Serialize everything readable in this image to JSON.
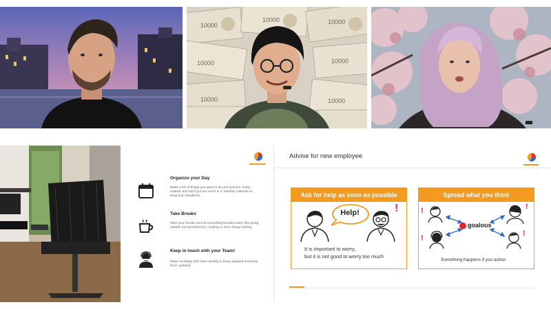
{
  "participants": [
    {
      "name": "",
      "background": "venice-canal"
    },
    {
      "name": "",
      "background": "yen-banknotes"
    },
    {
      "name": "",
      "background": "cherry-blossom"
    },
    {
      "name": "",
      "background": "home-office"
    }
  ],
  "slide1": {
    "tips": [
      {
        "icon": "calendar-icon",
        "title": "Organize your Day",
        "body": "Make a list of things you want to do and achieve. Keep realistic and don't put too much in it. Monthly calendar to keep your deadlines."
      },
      {
        "icon": "coffee-cup-icon",
        "title": "Take Breaks",
        "body": "Take your breaks and do something besides work, like going outside (social distance), cooking or even doing nothing."
      },
      {
        "icon": "headset-person-icon",
        "title": "Keep in touch with your Team!",
        "body": "Make meetings with them weekly to keep updated and keep them updated."
      }
    ]
  },
  "slide2": {
    "title": "Advise for new employee",
    "panel_left": {
      "header": "Ask for help as soon as possible",
      "bubble": "Help!",
      "caption_line1": "It is important to worry,",
      "caption_line2": "but it is not good to worry too much"
    },
    "panel_right": {
      "header": "Spread what you think",
      "brand": "goalous",
      "caption": "Something happens if you action"
    }
  },
  "colors": {
    "accent_orange": "#f39a1f",
    "exclaim_red": "#e02a2a"
  }
}
